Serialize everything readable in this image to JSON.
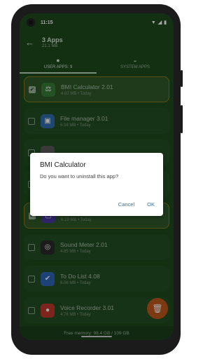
{
  "status": {
    "time": "11:15",
    "icons": [
      "wifi-icon",
      "signal-icon",
      "battery-icon"
    ]
  },
  "appbar": {
    "title": "3 Apps",
    "subtitle": "21.1 MB"
  },
  "tabs": [
    {
      "label": "USER APPS: 9",
      "icon": "person-icon"
    },
    {
      "label": "SYSTEM APPS",
      "icon": "android-icon"
    }
  ],
  "apps": [
    {
      "name": "BMI Calculator 2.01",
      "meta": "4.62 MB  •  Today",
      "checked": true,
      "icon_color": "#3a7f3a",
      "glyph": "⚖"
    },
    {
      "name": "File manager 3.01",
      "meta": "5.58 MB  •  Today",
      "checked": false,
      "icon_color": "#2f6fb0",
      "glyph": "▣"
    },
    {
      "name": "",
      "meta": "",
      "checked": false,
      "icon_color": "#5a5a5a",
      "glyph": ""
    },
    {
      "name": "",
      "meta": "",
      "checked": false,
      "icon_color": "#5a5a5a",
      "glyph": ""
    },
    {
      "name": "Screenshot 3.01",
      "meta": "6.19 MB  •  Today",
      "checked": true,
      "icon_color": "#4a3aa8",
      "glyph": "▢"
    },
    {
      "name": "Sound Meter 2.01",
      "meta": "4.65 MB  •  Today",
      "checked": false,
      "icon_color": "#2a2a2a",
      "glyph": "◎"
    },
    {
      "name": "To Do List 4.08",
      "meta": "6.06 MB  •  Today",
      "checked": false,
      "icon_color": "#2b66b8",
      "glyph": "✔"
    },
    {
      "name": "Voice Recorder 3.01",
      "meta": "4.76 MB  •  Today",
      "checked": false,
      "icon_color": "#c0392b",
      "glyph": "●"
    }
  ],
  "footer": {
    "memory": "Free memory: 98.4 GB / 109 GB"
  },
  "dialog": {
    "title": "BMI Calculator",
    "message": "Do you want to uninstall this app?",
    "cancel": "Cancel",
    "ok": "OK"
  },
  "colors": {
    "bg": "#1e4a1e",
    "fab": "#c15a1c",
    "dialog_button": "#2a6fb8"
  }
}
